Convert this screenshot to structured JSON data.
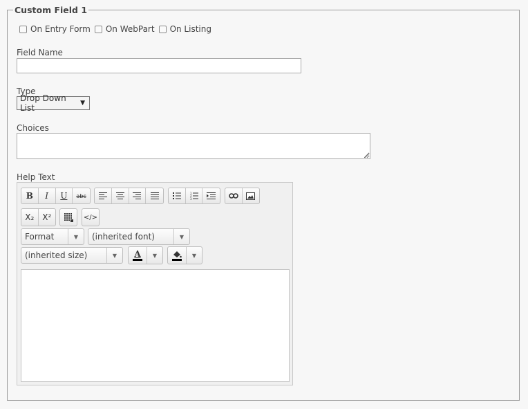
{
  "section": {
    "legend": "Custom Field 1"
  },
  "options": [
    {
      "label": "On Entry Form",
      "checked": false
    },
    {
      "label": "On WebPart",
      "checked": false
    },
    {
      "label": "On Listing",
      "checked": false
    }
  ],
  "field_name": {
    "label": "Field Name",
    "value": ""
  },
  "type": {
    "label": "Type",
    "selected": "Drop Down List",
    "arrow": "▼"
  },
  "choices": {
    "label": "Choices",
    "value": ""
  },
  "help_text": {
    "label": "Help Text",
    "toolbar": {
      "bold": "B",
      "italic": "I",
      "underline": "U",
      "strike": "abc",
      "subscript": "X₂",
      "superscript": "X²",
      "source": "</>",
      "format_label": "Format",
      "font_label": "(inherited font)",
      "size_label": "(inherited size)",
      "text_color_glyph": "A",
      "dropdown_arrow": "▼"
    },
    "content": ""
  }
}
